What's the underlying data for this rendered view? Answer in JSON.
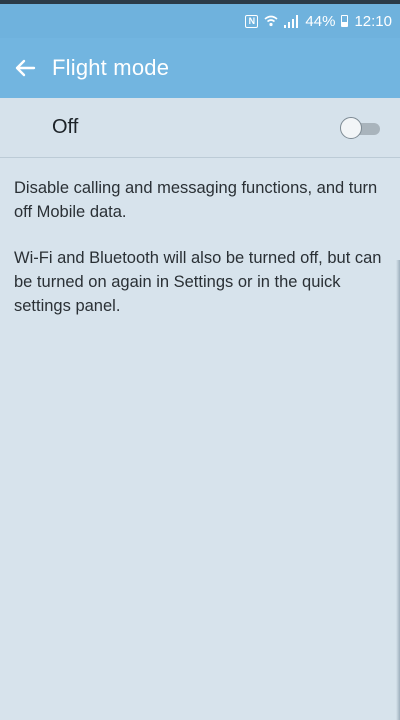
{
  "status_bar": {
    "nfc_icon": "nfc-icon",
    "wifi_icon": "wifi-icon",
    "signal_icon": "signal-icon",
    "battery_percent": "44%",
    "battery_icon": "battery-icon",
    "time": "12:10"
  },
  "app_bar": {
    "back_icon": "arrow-left-icon",
    "title": "Flight mode"
  },
  "toggle": {
    "label": "Off",
    "state": "off"
  },
  "description": {
    "paragraph_1": "Disable calling and messaging functions, and turn off Mobile data.",
    "paragraph_2": "Wi-Fi and Bluetooth will also be turned off, but can be turned on again in Settings or in the quick settings panel."
  },
  "colors": {
    "header": "#72b5e0",
    "background": "#d7e3ec",
    "text": "#2a3035"
  }
}
